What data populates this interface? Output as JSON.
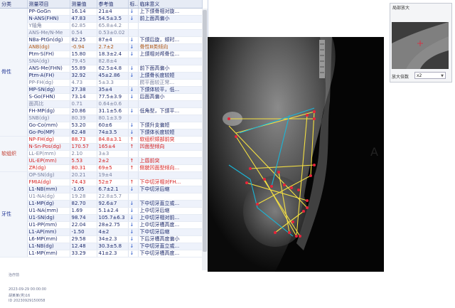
{
  "table": {
    "headers": [
      "分类",
      "测量项目",
      "测量值",
      "参考值",
      "标...",
      "临床意义"
    ],
    "categories": {
      "bone": "骨性",
      "soft": "软组织",
      "tooth": "牙性"
    },
    "rows": [
      {
        "item": "PP-GoGn",
        "value": "16.14",
        "ref": "21±4",
        "flag": "↓",
        "meaning": "上下颌骨相对旋...",
        "color": "black"
      },
      {
        "item": "N-ANS(FHN)",
        "value": "47.83",
        "ref": "54.5±3.5",
        "flag": "↓",
        "meaning": "前上面高偏小",
        "color": "black"
      },
      {
        "item": "Y轴角",
        "value": "62.85",
        "ref": "65.8±4.2",
        "flag": "",
        "meaning": "",
        "color": "gray"
      },
      {
        "item": "ANS-Me/N-Me",
        "value": "0.54",
        "ref": "0.53±0.02",
        "flag": "",
        "meaning": "",
        "color": "gray"
      },
      {
        "item": "NBa-PtGn(dg)",
        "value": "82.25",
        "ref": "87±4",
        "flag": "↓",
        "meaning": "下颌后旋，颏时...",
        "color": "black"
      },
      {
        "item": "ANB(dg)",
        "value": "-0.94",
        "ref": "2.7±2",
        "flag": "↓",
        "meaning": "骨性Ⅲ类倾向",
        "color": "brown"
      },
      {
        "item": "Ptm-S(FH)",
        "value": "15.80",
        "ref": "18.3±2.4",
        "flag": "↓",
        "meaning": "上颌相对颅骨位...",
        "color": "black"
      },
      {
        "item": "SNA(dg)",
        "value": "79.45",
        "ref": "82.8±4",
        "flag": "",
        "meaning": "",
        "color": "gray"
      },
      {
        "item": "ANS-Me(FHN)",
        "value": "55.89",
        "ref": "62.5±4.8",
        "flag": "↓",
        "meaning": "前下面高偏小",
        "color": "black"
      },
      {
        "item": "Ptm-A(FH)",
        "value": "32.92",
        "ref": "45±2.86",
        "flag": "↓",
        "meaning": "上颌骨长度较短",
        "color": "black"
      },
      {
        "item": "PP-FH(dg)",
        "value": "4.73",
        "ref": "5±3.3",
        "flag": "",
        "meaning": "腭平面较正常...",
        "color": "gray"
      },
      {
        "item": "MP-SN(dg)",
        "value": "27.38",
        "ref": "35±4",
        "flag": "↓",
        "meaning": "下颌体较平，低...",
        "color": "black"
      },
      {
        "item": "S-Go(FHN)",
        "value": "73.14",
        "ref": "77.5±3.9",
        "flag": "↓",
        "meaning": "后面高偏小",
        "color": "black"
      },
      {
        "item": "面高比",
        "value": "0.71",
        "ref": "0.64±0.6",
        "flag": "",
        "meaning": "",
        "color": "gray"
      },
      {
        "item": "FH-MP(dg)",
        "value": "20.86",
        "ref": "31.1±5.6",
        "flag": "↓",
        "meaning": "低角型，下颌平...",
        "color": "black"
      },
      {
        "item": "SNB(dg)",
        "value": "80.39",
        "ref": "80.1±3.9",
        "flag": "",
        "meaning": "",
        "color": "gray"
      },
      {
        "item": "Go-Co(mm)",
        "value": "53.20",
        "ref": "60±6",
        "flag": "↓",
        "meaning": "下颌升支偏短",
        "color": "black"
      },
      {
        "item": "Go-Po(MP)",
        "value": "62.48",
        "ref": "74±3.5",
        "flag": "↓",
        "meaning": "下颌体长度较短",
        "color": "black"
      },
      {
        "item": "NP-FH(dg)",
        "value": "88.73",
        "ref": "84.8±3.1",
        "flag": "↑",
        "meaning": "软组织颏部前突",
        "color": "red"
      },
      {
        "item": "N-Sn-Pos(dg)",
        "value": "170.57",
        "ref": "165±4",
        "flag": "↑",
        "meaning": "凹面型倾向",
        "color": "red"
      },
      {
        "item": "LL-EP(mm)",
        "value": "2.10",
        "ref": "3±3",
        "flag": "",
        "meaning": "",
        "color": "gray"
      },
      {
        "item": "UL-EP(mm)",
        "value": "5.53",
        "ref": "2±2",
        "flag": "↑",
        "meaning": "上唇前突",
        "color": "red"
      },
      {
        "item": "ZR(dg)",
        "value": "80.31",
        "ref": "69±5",
        "flag": "↑",
        "meaning": "侧貌凹面型倾向...",
        "color": "red"
      },
      {
        "item": "OP-SN(dg)",
        "value": "20.21",
        "ref": "19±4",
        "flag": "",
        "meaning": "",
        "color": "gray"
      },
      {
        "item": "FMIA(dg)",
        "value": "74.43",
        "ref": "52±7",
        "flag": "↑",
        "meaning": "下中切牙相对FH...",
        "color": "red"
      },
      {
        "item": "L1-NB(mm)",
        "value": "-1.05",
        "ref": "6.7±2.1",
        "flag": "↓",
        "meaning": "下中切牙后缩",
        "color": "black"
      },
      {
        "item": "U1-NA(dg)",
        "value": "19.28",
        "ref": "22.8±5.7",
        "flag": "",
        "meaning": "",
        "color": "gray"
      },
      {
        "item": "L1-MP(dg)",
        "value": "82.70",
        "ref": "92.6±7",
        "flag": "↓",
        "meaning": "下中切牙直立或...",
        "color": "black"
      },
      {
        "item": "U1-NA(mm)",
        "value": "1.69",
        "ref": "5.1±2.4",
        "flag": "↓",
        "meaning": "上中切牙后缩",
        "color": "black"
      },
      {
        "item": "U1-SN(dg)",
        "value": "98.74",
        "ref": "105.7±6.3",
        "flag": "↓",
        "meaning": "上中切牙相对前...",
        "color": "black"
      },
      {
        "item": "U1-PP(mm)",
        "value": "22.04",
        "ref": "28±2.75",
        "flag": "↓",
        "meaning": "上中切牙槽高度...",
        "color": "black"
      },
      {
        "item": "L1-AP(mm)",
        "value": "-1.50",
        "ref": "4±2",
        "flag": "↓",
        "meaning": "下中切牙后缩",
        "color": "black"
      },
      {
        "item": "L6-MP(mm)",
        "value": "29.58",
        "ref": "34±2.3",
        "flag": "↓",
        "meaning": "下后牙槽高度偏小",
        "color": "black"
      },
      {
        "item": "L1-NB(dg)",
        "value": "12.48",
        "ref": "30.3±5.8",
        "flag": "↓",
        "meaning": "下中切牙直立或...",
        "color": "black"
      },
      {
        "item": "L1-MP(mm)",
        "value": "33.29",
        "ref": "41±2.3",
        "flag": "↓",
        "meaning": "下中切牙槽高度...",
        "color": "black"
      }
    ]
  },
  "footer": {
    "doctor": "治疗前",
    "datetime": "2023-09-29 00:00:00",
    "patient": "胡某某(男)16",
    "id": "ID 20230929150058"
  },
  "zoom_panel": {
    "title": "局部放大",
    "magnification_label": "放大倍数",
    "magnification_value": "x2"
  },
  "view_label": "A",
  "colors": {
    "text": "#1d2a6b",
    "warn_red": "#d42020",
    "gray": "#7a82a0",
    "brown": "#b05a18",
    "header_bg": "#e6ebf5",
    "tracing_yellow": "#f5e042",
    "tracing_cyan": "#19b6d8",
    "landmark_red": "#e8243a"
  }
}
